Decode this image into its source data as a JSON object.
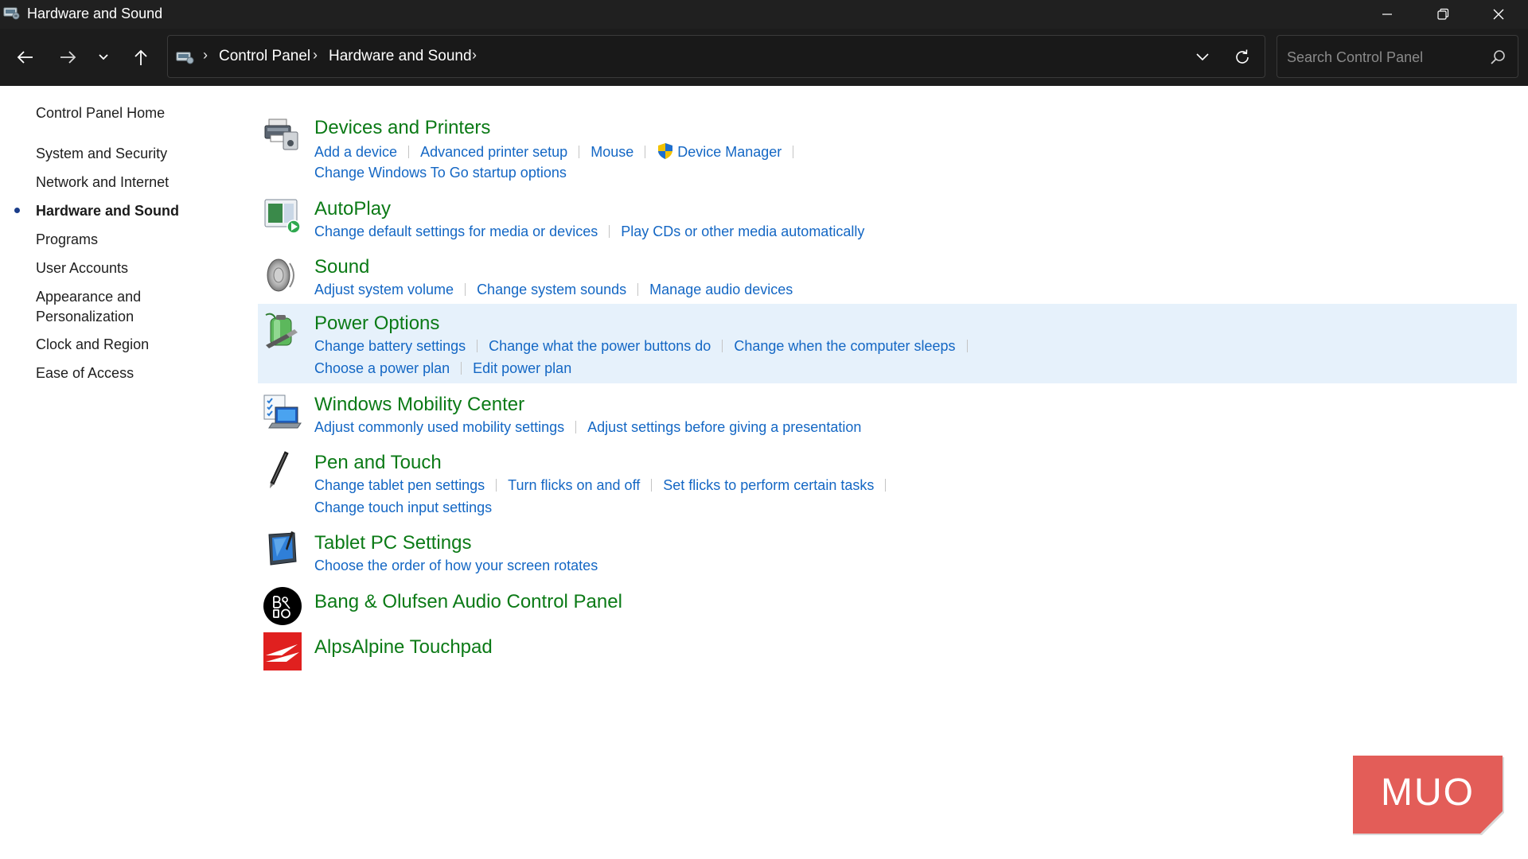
{
  "window": {
    "title": "Hardware and Sound"
  },
  "address": {
    "crumbs": [
      "Control Panel",
      "Hardware and Sound"
    ]
  },
  "search": {
    "placeholder": "Search Control Panel"
  },
  "sidebar": {
    "home": "Control Panel Home",
    "items": [
      {
        "label": "System and Security"
      },
      {
        "label": "Network and Internet"
      },
      {
        "label": "Hardware and Sound",
        "active": true
      },
      {
        "label": "Programs"
      },
      {
        "label": "User Accounts"
      },
      {
        "label": "Appearance and Personalization"
      },
      {
        "label": "Clock and Region"
      },
      {
        "label": "Ease of Access"
      }
    ]
  },
  "categories": [
    {
      "title": "Devices and Printers",
      "icon": "printer-icon",
      "links": [
        [
          "Add a device",
          "Advanced printer setup",
          "Mouse",
          "Device Manager"
        ],
        [
          "Change Windows To Go startup options"
        ]
      ]
    },
    {
      "title": "AutoPlay",
      "icon": "autoplay-icon",
      "links": [
        [
          "Change default settings for media or devices",
          "Play CDs or other media automatically"
        ]
      ]
    },
    {
      "title": "Sound",
      "icon": "speaker-icon",
      "links": [
        [
          "Adjust system volume",
          "Change system sounds",
          "Manage audio devices"
        ]
      ]
    },
    {
      "title": "Power Options",
      "icon": "battery-icon",
      "highlighted": true,
      "links": [
        [
          "Change battery settings",
          "Change what the power buttons do",
          "Change when the computer sleeps"
        ],
        [
          "Choose a power plan",
          "Edit power plan"
        ]
      ]
    },
    {
      "title": "Windows Mobility Center",
      "icon": "mobility-center-icon",
      "links": [
        [
          "Adjust commonly used mobility settings",
          "Adjust settings before giving a presentation"
        ]
      ]
    },
    {
      "title": "Pen and Touch",
      "icon": "pen-icon",
      "links": [
        [
          "Change tablet pen settings",
          "Turn flicks on and off",
          "Set flicks to perform certain tasks"
        ],
        [
          "Change touch input settings"
        ]
      ]
    },
    {
      "title": "Tablet PC Settings",
      "icon": "tablet-icon",
      "links": [
        [
          "Choose the order of how your screen rotates"
        ]
      ]
    },
    {
      "title": "Bang & Olufsen Audio Control Panel",
      "icon": "bang-olufsen-logo-icon",
      "links": []
    },
    {
      "title": "AlpsAlpine Touchpad",
      "icon": "alpsalpine-logo-icon",
      "links": []
    }
  ],
  "colors": {
    "title_green": "#0b7a16",
    "link_blue": "#1467c4",
    "highlight": "#e6f1fb",
    "chrome_dark": "#202020"
  },
  "watermark": {
    "text": "MUO"
  }
}
